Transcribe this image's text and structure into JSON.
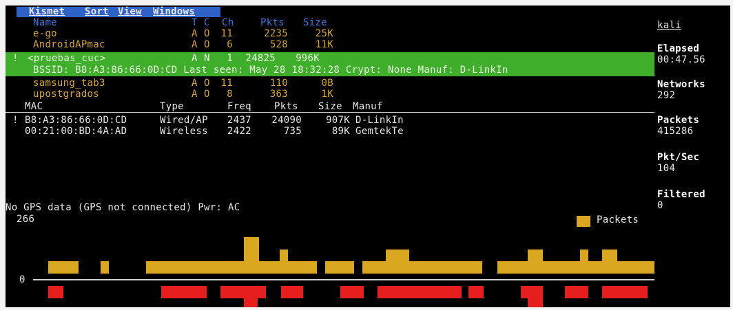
{
  "menu": {
    "items": [
      "Kismet",
      "Sort",
      "View",
      "Windows"
    ]
  },
  "network_list": {
    "headers": {
      "name": "Name",
      "t": "T",
      "c": "C",
      "ch": "Ch",
      "pkts": "Pkts",
      "size": "Size"
    },
    "rows": [
      {
        "flag": "",
        "name": "e-go",
        "t": "A",
        "c": "O",
        "ch": "11",
        "pkts": "2235",
        "size": "25K"
      },
      {
        "flag": "",
        "name": "AndroidAPmac",
        "t": "A",
        "c": "O",
        "ch": "6",
        "pkts": "528",
        "size": "11K"
      },
      {
        "flag": "!",
        "name": "<pruebas_cuc>",
        "t": "A",
        "c": "N",
        "ch": "1",
        "pkts": "24825",
        "size": "996K"
      },
      {
        "flag": "",
        "name": "samsung_tab3",
        "t": "A",
        "c": "O",
        "ch": "11",
        "pkts": "110",
        "size": "0B"
      },
      {
        "flag": "",
        "name": "upostgrados",
        "t": "A",
        "c": "O",
        "ch": "8",
        "pkts": "363",
        "size": "1K"
      }
    ],
    "selected_detail": "BSSID: B8:A3:86:66:0D:CD Last seen: May 28 18:32:28 Crypt: None Manuf: D-LinkIn"
  },
  "client_list": {
    "headers": {
      "mac": "MAC",
      "type": "Type",
      "freq": "Freq",
      "pkts": "Pkts",
      "size": "Size",
      "manuf": "Manuf"
    },
    "rows": [
      {
        "flag": "!",
        "mac": "B8:A3:86:66:0D:CD",
        "type": "Wired/AP",
        "freq": "2437",
        "pkts": "24090",
        "size": "907K",
        "manuf": "D-LinkIn"
      },
      {
        "flag": "",
        "mac": "00:21:00:BD:4A:AD",
        "type": "Wireless",
        "freq": "2422",
        "pkts": "735",
        "size": "89K",
        "manuf": "GemtekTe"
      }
    ]
  },
  "gps_status": "No GPS data (GPS not connected) Pwr: AC",
  "graph": {
    "y_max_label": "266",
    "y_min_label": "0",
    "legend": "Packets",
    "colors": {
      "packets": "#d9a820",
      "secondary": "#e61e1e"
    }
  },
  "stats": {
    "host": "kali",
    "elapsed_label": "Elapsed",
    "elapsed": "00:47.56",
    "networks_label": "Networks",
    "networks": "292",
    "packets_label": "Packets",
    "packets": "415286",
    "pktsec_label": "Pkt/Sec",
    "pktsec": "104",
    "filtered_label": "Filtered",
    "filtered": "0"
  }
}
